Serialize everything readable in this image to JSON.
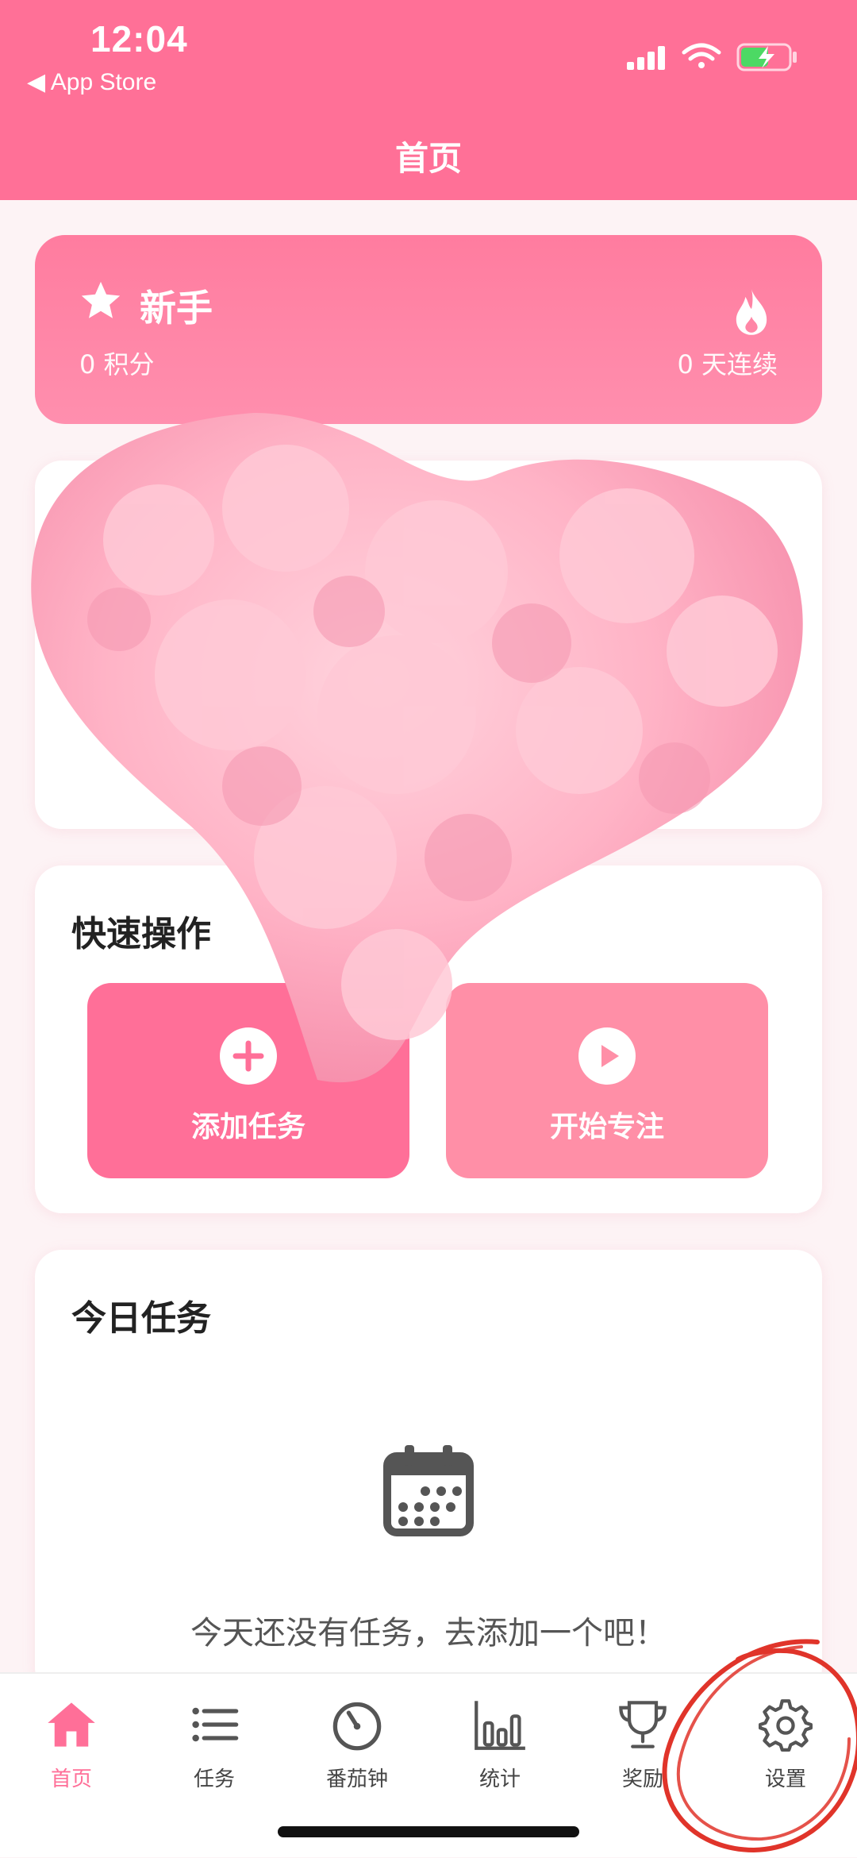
{
  "status_bar": {
    "time": "12:04",
    "back_label": "◀ App Store"
  },
  "header": {
    "title": "首页"
  },
  "level_card": {
    "level_name": "新手",
    "points_text": "0 积分",
    "streak_text": "0 天连续"
  },
  "quick_actions": {
    "title": "快速操作",
    "add_task_label": "添加任务",
    "start_focus_label": "开始专注"
  },
  "today": {
    "title": "今日任务",
    "empty_text": "今天还没有任务，去添加一个吧！"
  },
  "tabs": [
    {
      "label": "首页",
      "icon": "home-icon",
      "active": true
    },
    {
      "label": "任务",
      "icon": "list-icon"
    },
    {
      "label": "番茄钟",
      "icon": "timer-icon"
    },
    {
      "label": "统计",
      "icon": "bar-chart-icon"
    },
    {
      "label": "奖励",
      "icon": "trophy-icon"
    },
    {
      "label": "设置",
      "icon": "gear-icon"
    }
  ],
  "colors": {
    "accent": "#ff7097",
    "secondary": "#ff8fa7",
    "annotation": "#e0342a"
  }
}
